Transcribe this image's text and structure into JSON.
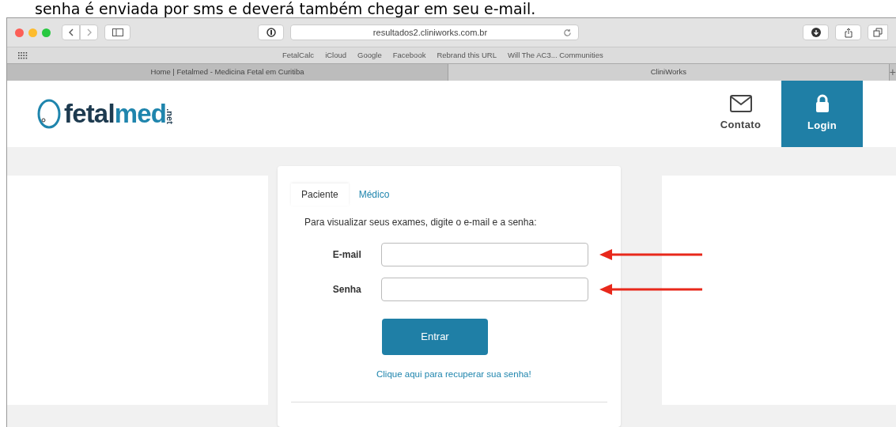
{
  "caption": "senha é enviada por sms e deverá também chegar em seu e-mail.",
  "browser": {
    "address": "resultados2.cliniworks.com.br",
    "bookmarks": [
      "FetalCalc",
      "iCloud",
      "Google",
      "Facebook",
      "Rebrand this URL",
      "Will The AC3... Communities"
    ],
    "tabs": [
      {
        "label": "Home | Fetalmed - Medicina Fetal em Curitiba",
        "selected": false
      },
      {
        "label": "CliniWorks",
        "selected": true
      }
    ],
    "new_tab": "+"
  },
  "header": {
    "logo_main": "fetal",
    "logo_accent": "med",
    "logo_suffix": ".net",
    "nav": [
      {
        "label": "Contato",
        "kind": "mail",
        "selected": false
      },
      {
        "label": "Login",
        "kind": "lock",
        "selected": true
      }
    ]
  },
  "login": {
    "tabs": [
      {
        "label": "Paciente",
        "selected": true
      },
      {
        "label": "Médico",
        "selected": false
      }
    ],
    "instruction": "Para visualizar seus exames, digite o e-mail e a senha:",
    "fields": [
      {
        "label": "E-mail"
      },
      {
        "label": "Senha"
      }
    ],
    "submit": "Entrar",
    "recover_link": "Clique aqui para recuperar sua senha!"
  }
}
